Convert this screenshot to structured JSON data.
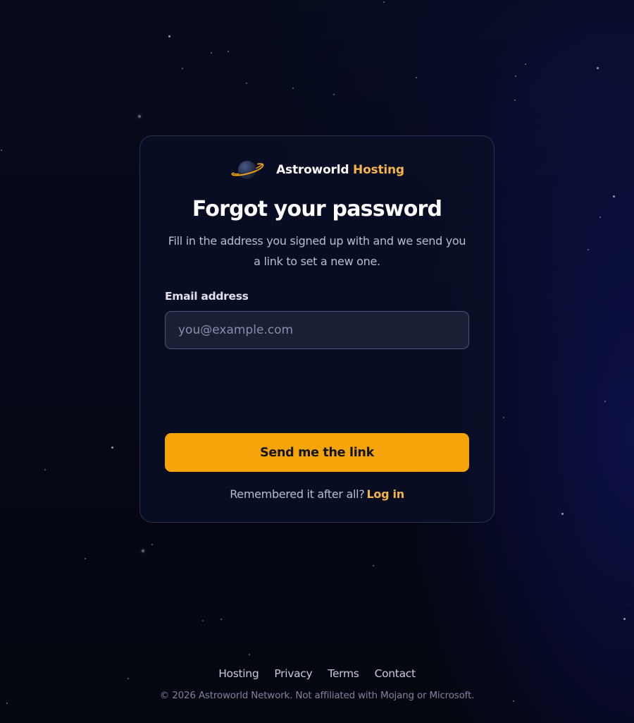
{
  "brand": {
    "name": "Astroworld",
    "accent": "Hosting",
    "logo_icon": "planet-icon",
    "accent_color": "#f4b44a"
  },
  "form": {
    "title": "Forgot your password",
    "subtitle": "Fill in the address you signed up with and we send you a link to set a new one.",
    "email_label": "Email address",
    "email_value": "",
    "email_placeholder": "you@example.com",
    "submit_label": "Send me the link",
    "submit_color": "#f5a50a"
  },
  "login_prompt": {
    "text": "Remembered it after all?",
    "link_label": "Log in"
  },
  "footer": {
    "links": [
      "Hosting",
      "Privacy",
      "Terms",
      "Contact"
    ],
    "copyright": "© 2026 Astroworld Network. Not affiliated with Mojang or Microsoft."
  }
}
